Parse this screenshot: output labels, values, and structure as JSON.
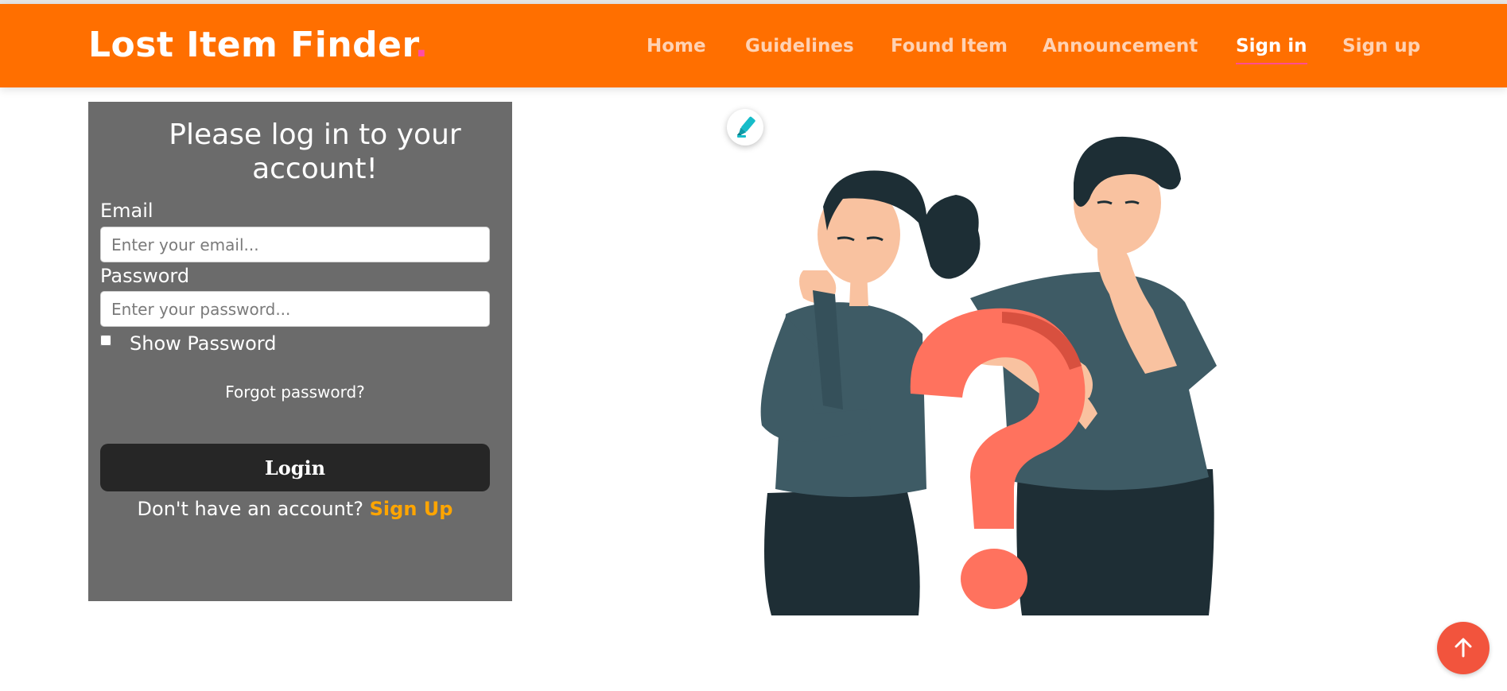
{
  "app": {
    "brand_text": "Lost Item Finder",
    "brand_dot": "."
  },
  "nav": {
    "items": [
      {
        "label": "Home"
      },
      {
        "label": "Guidelines"
      },
      {
        "label": "Found Item"
      },
      {
        "label": "Announcement"
      },
      {
        "label": "Sign in",
        "active": true
      },
      {
        "label": "Sign up"
      }
    ]
  },
  "login": {
    "title": "Please log in to your account!",
    "email_label": "Email",
    "email_value": "",
    "email_placeholder": "Enter your email...",
    "password_label": "Password",
    "password_value": "",
    "password_placeholder": "Enter your password...",
    "show_password_label": "Show Password",
    "show_password_checked": false,
    "forgot_label": "Forgot password?",
    "login_label": "Login",
    "signup_prompt": "Don't have an account?",
    "signup_link": "Sign Up"
  },
  "icons": {
    "edit": "highlighter-pen-icon",
    "scroll_top": "arrow-up-icon",
    "illustration": "confused-people-question-mark-illustration"
  },
  "colors": {
    "header": "#ff6f00",
    "panel": "#6b6b6b",
    "button": "#262626",
    "link": "#ffa500",
    "accent_dot": "#ff4da6",
    "scroll_top": "#f2543d"
  }
}
